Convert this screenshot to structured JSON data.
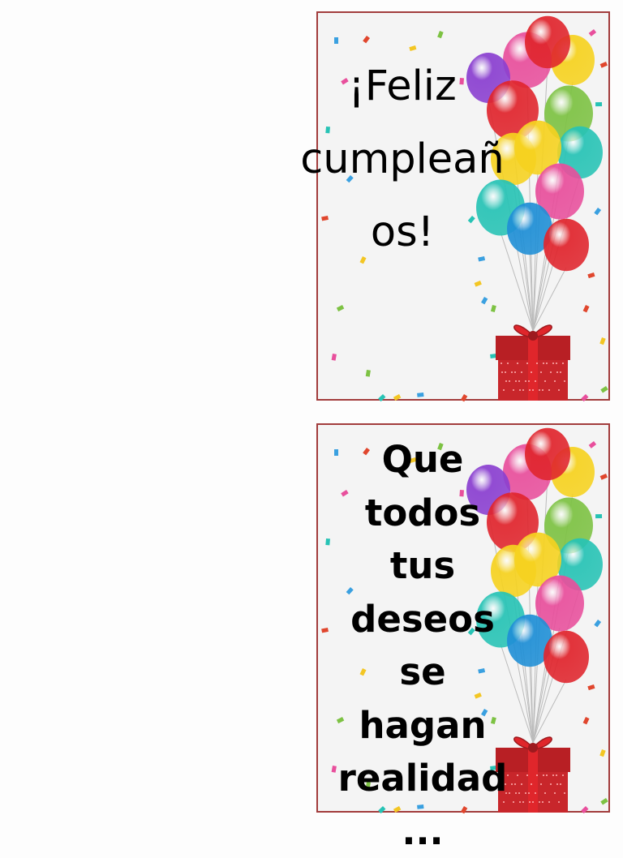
{
  "cards": [
    {
      "message_lines": [
        "¡Feliz",
        "cumpleañ",
        "os!"
      ]
    },
    {
      "message_lines": [
        "Que",
        "todos",
        "tus",
        "deseos",
        "se",
        "hagan",
        "realidad",
        "..."
      ]
    }
  ],
  "colors": {
    "border": "#a23c3c",
    "card_background": "#f4f4f4",
    "gift_box": "#c8262b",
    "ribbon": "#e0262b",
    "balloons": [
      "#e0252d",
      "#f6d21f",
      "#7dc243",
      "#27c3b5",
      "#e84f9c",
      "#8a3fd0",
      "#1f8fd6"
    ]
  },
  "icons": [
    "balloon-bunch-icon",
    "gift-box-icon",
    "confetti-icon"
  ]
}
